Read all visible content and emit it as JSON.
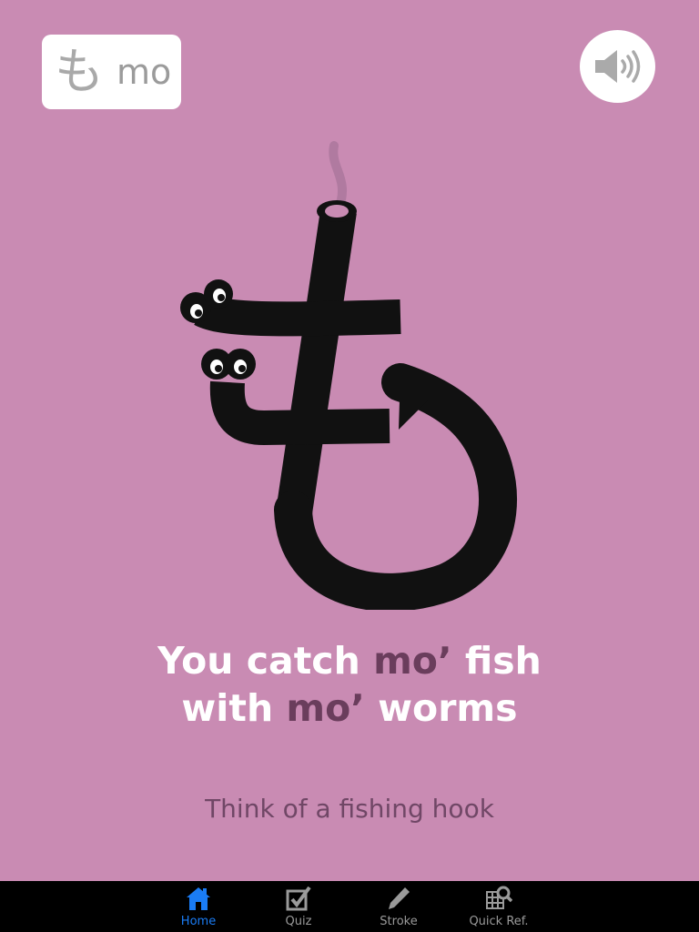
{
  "badge": {
    "kana": "も",
    "romaji": "mo"
  },
  "sound": {
    "icon": "speaker-icon"
  },
  "illustration": {
    "description_icon": "hook-worm-mo-illustration"
  },
  "mnemonic": {
    "line1_pre": "You catch ",
    "line1_hl": "mo’",
    "line1_post": " fish",
    "line2_pre": "with ",
    "line2_hl": "mo’",
    "line2_post": " worms"
  },
  "hint": "Think of a fishing hook",
  "tabs": [
    {
      "label": "Home",
      "icon": "home-icon",
      "active": true
    },
    {
      "label": "Quiz",
      "icon": "checkbox-icon",
      "active": false
    },
    {
      "label": "Stroke",
      "icon": "pencil-icon",
      "active": false
    },
    {
      "label": "Quick Ref.",
      "icon": "grid-search-icon",
      "active": false
    }
  ],
  "colors": {
    "background": "#c98bb3",
    "highlight": "#6a3d5c",
    "tab_active": "#1a7cf5",
    "tab_inactive": "#9a9a9a"
  }
}
